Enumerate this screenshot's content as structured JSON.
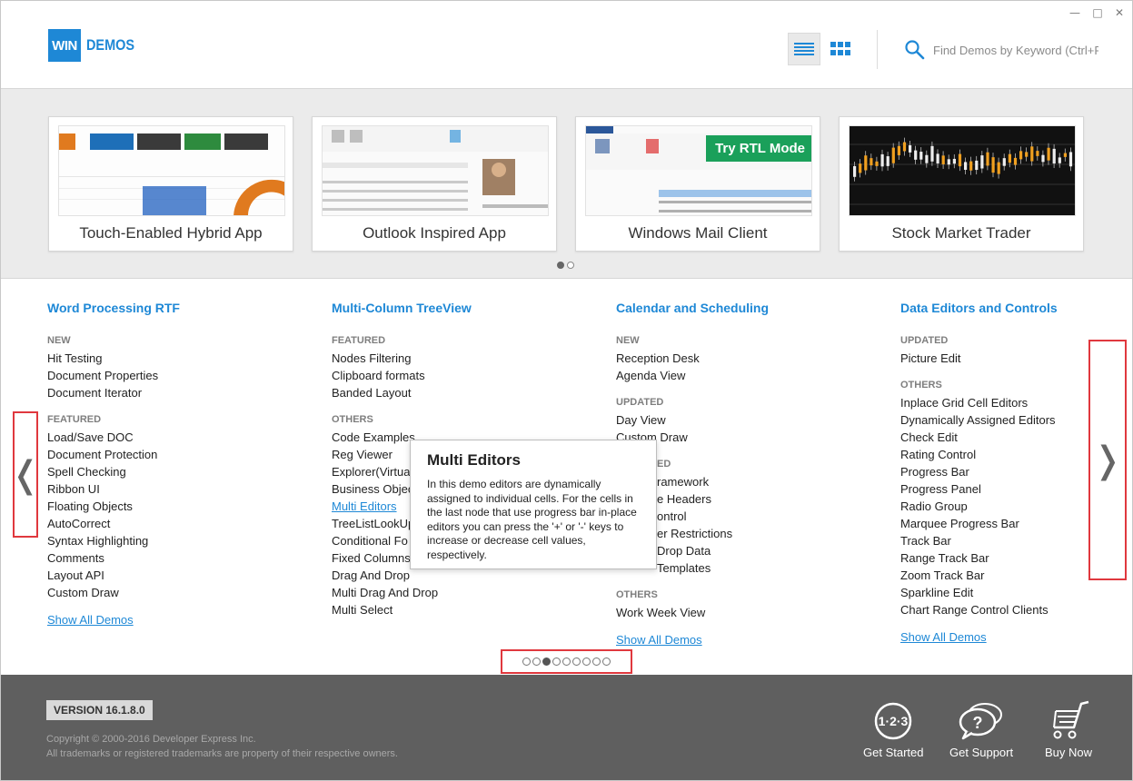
{
  "window": {
    "minimize": "—",
    "maximize": "□",
    "close": "✕"
  },
  "header": {
    "logo_box": "WIN",
    "logo_text": "DEMOS",
    "search_placeholder": "Find Demos by Keyword (Ctrl+F)"
  },
  "gallery": {
    "cards": [
      {
        "title": "Touch-Enabled Hybrid App"
      },
      {
        "title": "Outlook Inspired App"
      },
      {
        "title": "Windows Mail Client",
        "badge": "Try RTL Mode"
      },
      {
        "title": "Stock Market Trader"
      }
    ]
  },
  "columns": [
    {
      "title": "Word Processing RTF",
      "sections": [
        {
          "label": "NEW",
          "items": [
            "Hit Testing",
            "Document Properties",
            "Document Iterator"
          ]
        },
        {
          "label": "FEATURED",
          "items": [
            "Load/Save DOC",
            "Document Protection",
            "Spell Checking",
            "Ribbon UI",
            "Floating Objects",
            "AutoCorrect",
            "Syntax Highlighting",
            "Comments",
            "Layout API",
            "Custom Draw"
          ]
        }
      ],
      "show_all": "Show All Demos"
    },
    {
      "title": "Multi-Column TreeView",
      "sections": [
        {
          "label": "FEATURED",
          "items": [
            "Nodes Filtering",
            "Clipboard formats",
            "Banded Layout"
          ]
        },
        {
          "label": "OTHERS",
          "items": [
            "Code Examples",
            "Reg Viewer",
            "Explorer(Virtual",
            "Business Objec",
            "Multi Editors",
            "TreeListLookUp",
            "Conditional Fo",
            "Fixed Columns",
            "Drag And Drop",
            "Multi Drag And Drop",
            "Multi Select"
          ]
        }
      ]
    },
    {
      "title": "Calendar and Scheduling",
      "sections": [
        {
          "label": "NEW",
          "items": [
            "Reception Desk",
            "Agenda View"
          ]
        },
        {
          "label": "UPDATED",
          "items": [
            "Day View",
            "Custom Draw"
          ]
        },
        {
          "label": "ED",
          "items": [
            "ramework",
            "e Headers",
            "ontrol",
            "er Restrictions",
            "Drop Data",
            "Templates"
          ]
        },
        {
          "label": "OTHERS",
          "items": [
            "Work Week View"
          ]
        }
      ],
      "show_all": "Show All Demos"
    },
    {
      "title": "Data Editors and Controls",
      "sections": [
        {
          "label": "UPDATED",
          "items": [
            "Picture Edit"
          ]
        },
        {
          "label": "OTHERS",
          "items": [
            "Inplace Grid Cell Editors",
            "Dynamically Assigned Editors",
            "Check Edit",
            "Rating Control",
            "Progress Bar",
            "Progress Panel",
            "Radio Group",
            "Marquee Progress Bar",
            "Track Bar",
            "Range Track Bar",
            "Zoom Track Bar",
            "Sparkline Edit",
            "Chart Range Control Clients"
          ]
        }
      ],
      "show_all": "Show All Demos"
    }
  ],
  "tooltip": {
    "title": "Multi Editors",
    "body": "In this demo editors are dynamically assigned to individual cells. For the cells in the last node that use progress bar in-place editors you can press the '+' or '-' keys to increase or decrease cell values, respectively."
  },
  "nav": {
    "prev": "❬",
    "next": "❭"
  },
  "pager": {
    "count": 9,
    "active": 2
  },
  "gallery_pager": {
    "count": 2,
    "active": 0
  },
  "footer": {
    "version": "VERSION 16.1.8.0",
    "copyright": "Copyright © 2000-2016 Developer Express Inc.",
    "trademarks": "All trademarks or registered trademarks are property of their respective owners.",
    "buttons": [
      {
        "label": "Get Started",
        "icon": "steps-123-icon"
      },
      {
        "label": "Get Support",
        "icon": "support-bubble-icon"
      },
      {
        "label": "Buy Now",
        "icon": "cart-icon"
      }
    ]
  },
  "colors": {
    "accent": "#1e88d6",
    "highlight_border": "#e0383e",
    "footer_bg": "#5f5f5f",
    "rtl_badge": "#1aa05a"
  }
}
